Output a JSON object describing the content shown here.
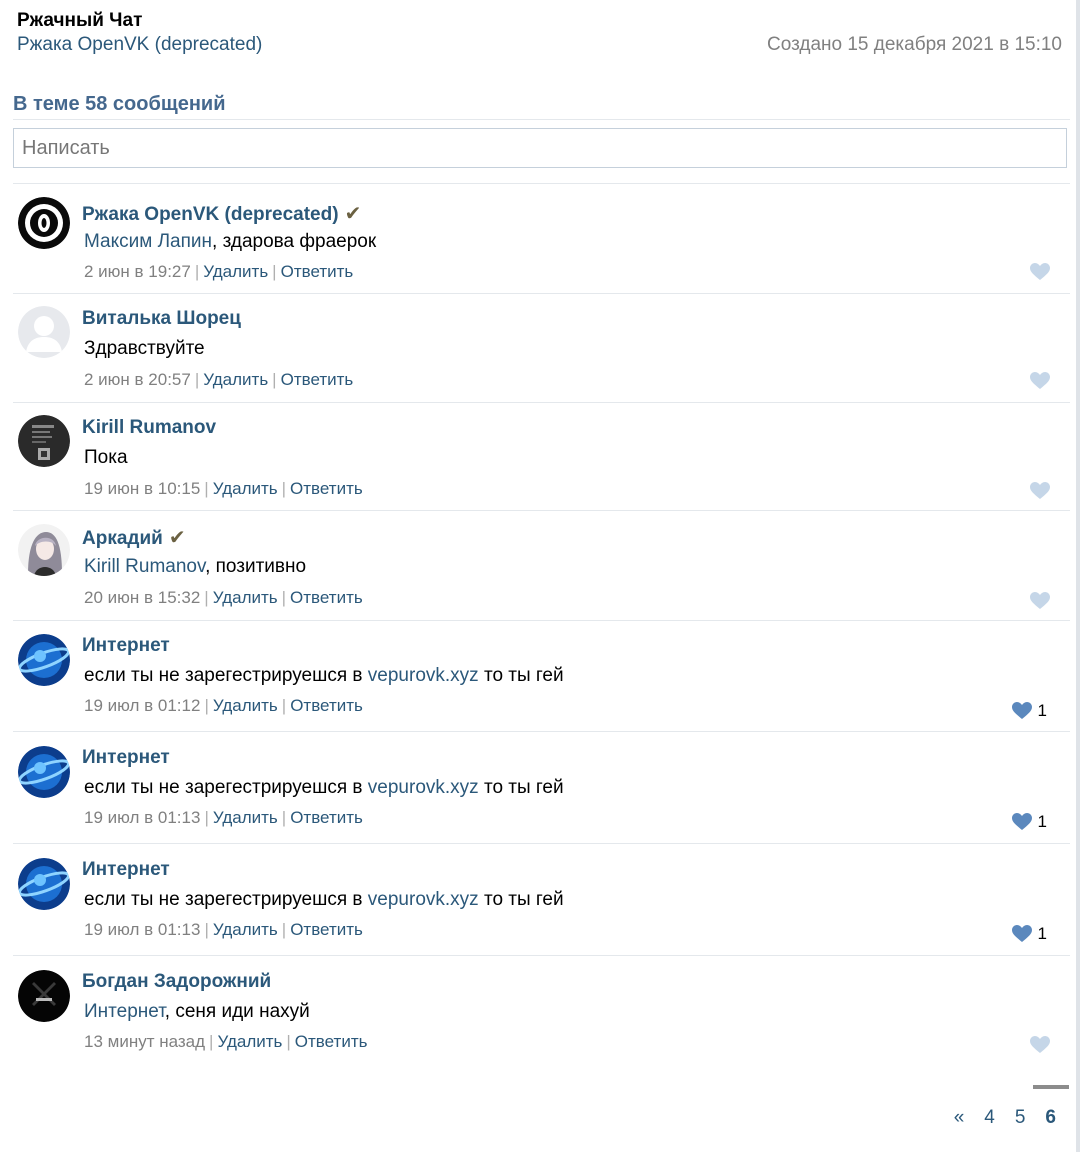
{
  "topic": {
    "title": "Ржачный Чат",
    "group_name": "Ржака OpenVK (deprecated)",
    "created": "Создано 15 декабря 2021 в 15:10"
  },
  "count_text": "В теме 58 сообщений",
  "compose": {
    "placeholder": "Написать"
  },
  "actions": {
    "delete": "Удалить",
    "reply": "Ответить"
  },
  "posts": [
    {
      "author": "Ржака OpenVK (deprecated)",
      "verified": true,
      "mention": "Максим Лапин",
      "text": ", здарова фраерок",
      "date": "2 июн в 19:27",
      "likes": ""
    },
    {
      "author": "Виталька Шорец",
      "verified": false,
      "mention": "",
      "text": "Здравствуйте",
      "date": "2 июн в 20:57",
      "likes": ""
    },
    {
      "author": "Kirill Rumanov",
      "verified": false,
      "mention": "",
      "text": "Пока",
      "date": "19 июн в 10:15",
      "likes": ""
    },
    {
      "author": "Аркадий",
      "verified": true,
      "mention": "Kirill Rumanov",
      "text": ", позитивно",
      "date": "20 июн в 15:32",
      "likes": ""
    },
    {
      "author": "Интернет",
      "verified": false,
      "text_before": "если ты не зарегестрируешся в ",
      "link": "vepurovk.xyz",
      "text_after": " то ты гей",
      "date": "19 июл в 01:12",
      "likes": "1"
    },
    {
      "author": "Интернет",
      "verified": false,
      "text_before": "если ты не зарегестрируешся в ",
      "link": "vepurovk.xyz",
      "text_after": " то ты гей",
      "date": "19 июл в 01:13",
      "likes": "1"
    },
    {
      "author": "Интернет",
      "verified": false,
      "text_before": "если ты не зарегестрируешся в ",
      "link": "vepurovk.xyz",
      "text_after": " то ты гей",
      "date": "19 июл в 01:13",
      "likes": "1"
    },
    {
      "author": "Богдан Задорожний",
      "verified": false,
      "mention": "Интернет",
      "text": ", сеня иди нахуй",
      "date": "13 минут назад",
      "likes": ""
    }
  ],
  "pagination": {
    "prev": "«",
    "pages": [
      "4",
      "5",
      "6"
    ],
    "current": "6"
  },
  "colors": {
    "link": "#2b587a",
    "heading": "#45688e",
    "like_empty": "#c5d6e8",
    "like_filled": "#5b88bd"
  },
  "icons": {
    "verified": "check-icon",
    "like": "heart-icon"
  }
}
